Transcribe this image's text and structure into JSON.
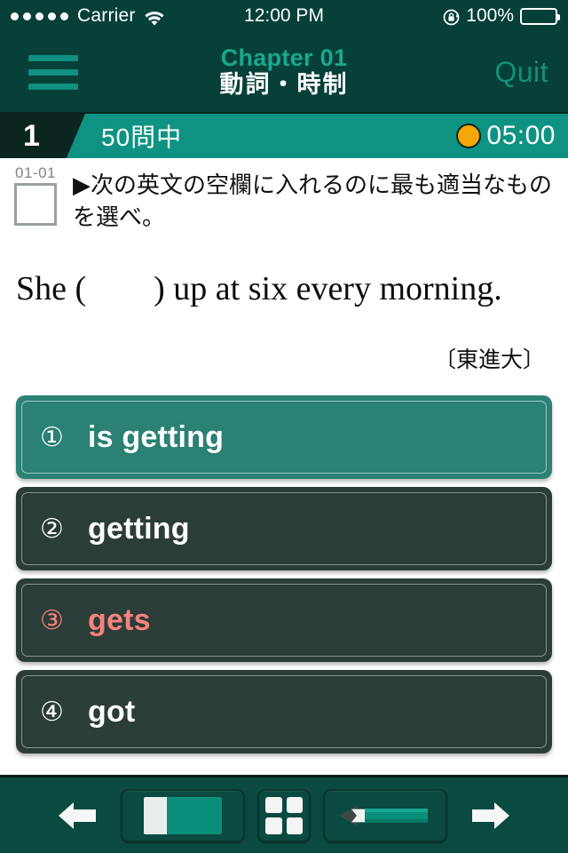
{
  "status_bar": {
    "signal_dots": 5,
    "carrier": "Carrier",
    "wifi_icon": "wifi-icon",
    "time": "12:00 PM",
    "rotation_lock_icon": "rotation-lock-icon",
    "battery_percent": "100%",
    "battery_level": 100
  },
  "nav": {
    "menu_icon": "hamburger-menu-icon",
    "chapter": "Chapter 01",
    "subtitle": "動詞・時制",
    "quit_label": "Quit"
  },
  "progress": {
    "current_number": "1",
    "total_label": "50問中",
    "timer_icon": "orange-circle-icon",
    "timer": "05:00"
  },
  "question": {
    "id": "01-01",
    "checkbox_checked": false,
    "prompt": "▶次の英文の空欄に入れるのに最も適当なものを選べ。",
    "sentence": "She (        ) up at six every morning.",
    "source": "〔東進大〕"
  },
  "choices": [
    {
      "number": "①",
      "text": "is getting",
      "state": "selected"
    },
    {
      "number": "②",
      "text": "getting",
      "state": "normal"
    },
    {
      "number": "③",
      "text": "gets",
      "state": "answer"
    },
    {
      "number": "④",
      "text": "got",
      "state": "normal"
    }
  ],
  "toolbar": {
    "prev_icon": "arrow-left-icon",
    "card_icon": "card-reveal-icon",
    "grid_icon": "grid-view-icon",
    "pencil_icon": "pencil-icon",
    "next_icon": "arrow-right-icon"
  },
  "colors": {
    "header_bg": "#064039",
    "progress_bg": "#0e9382",
    "accent_teal": "#1aa88f",
    "choice_bg": "#2b3d38",
    "choice_selected_bg": "#2a8174",
    "answer_red": "#f9827e",
    "timer_orange": "#f5a609",
    "toolbar_bg": "#0b4a40"
  }
}
